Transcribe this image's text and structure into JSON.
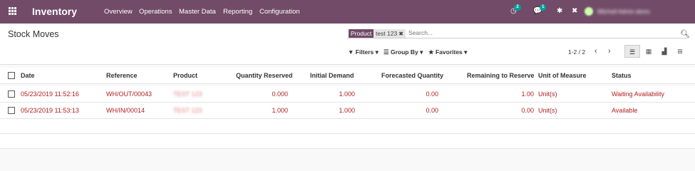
{
  "navbar": {
    "app_title": "Inventory",
    "menu": [
      "Overview",
      "Operations",
      "Master Data",
      "Reporting",
      "Configuration"
    ],
    "activity_count": "2",
    "messages_count": "1",
    "user_name": "Mitchell Admin demo"
  },
  "control_panel": {
    "title": "Stock Moves",
    "facet_key": "Product",
    "facet_value": "test 123",
    "search_placeholder": "Search...",
    "filters_label": "Filters",
    "groupby_label": "Group By",
    "favorites_label": "Favorites",
    "pager": "1-2 / 2"
  },
  "table": {
    "headers": [
      "Date",
      "Reference",
      "Product",
      "Quantity Reserved",
      "Initial Demand",
      "Forecasted Quantity",
      "Remaining to Reserve",
      "Unit of Measure",
      "Status"
    ],
    "rows": [
      {
        "date": "05/23/2019 11:52:16",
        "reference": "WH/OUT/00043",
        "product": "TEST 123",
        "reserved": "0.000",
        "demand": "1.000",
        "forecast": "0.00",
        "remaining": "1.00",
        "uom": "Unit(s)",
        "status": "Waiting Availability"
      },
      {
        "date": "05/23/2019 11:53:13",
        "reference": "WH/IN/00014",
        "product": "TEST 123",
        "reserved": "1.000",
        "demand": "1.000",
        "forecast": "0.00",
        "remaining": "0.00",
        "uom": "Unit(s)",
        "status": "Available"
      }
    ]
  },
  "colors": {
    "brand": "#714b67",
    "link": "#b01e1e",
    "badge": "#00a09d"
  }
}
